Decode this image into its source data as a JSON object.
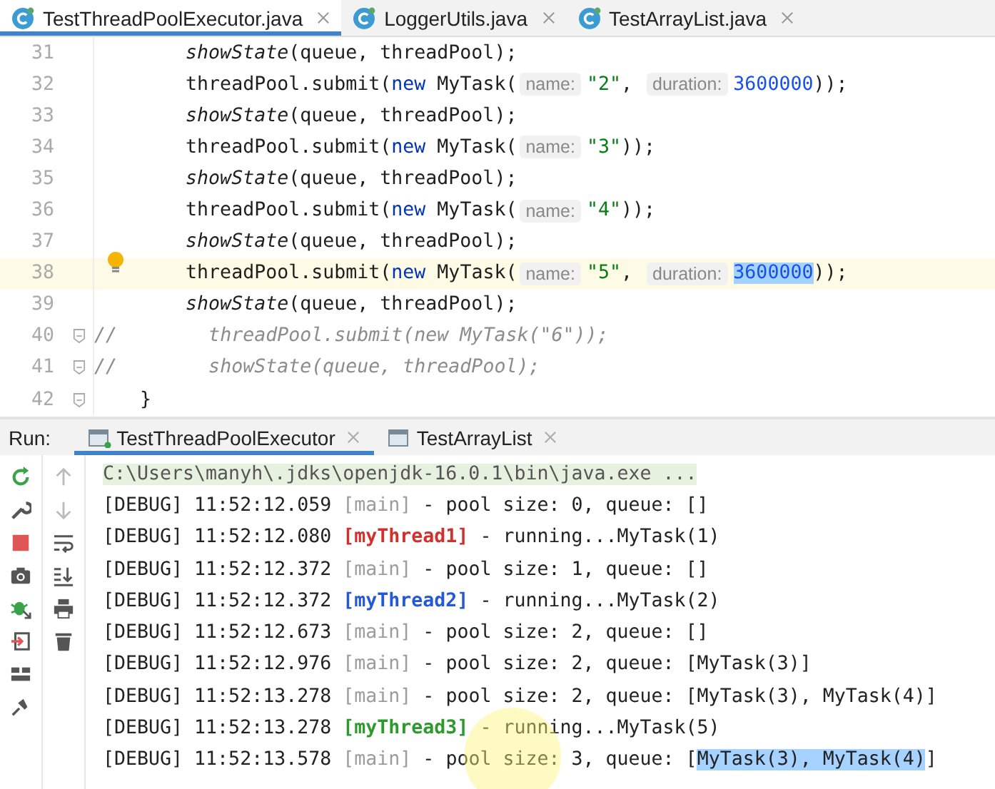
{
  "editor": {
    "tabs": [
      {
        "label": "TestThreadPoolExecutor.java",
        "selected": true
      },
      {
        "label": "LoggerUtils.java",
        "selected": false
      },
      {
        "label": "TestArrayList.java",
        "selected": false
      }
    ],
    "lines": [
      {
        "number": "31",
        "current": false,
        "bulb": false,
        "fold": false,
        "segments": [
          {
            "text": "        showState",
            "kind": "call"
          },
          {
            "text": "(queue, threadPool);",
            "kind": "plain"
          }
        ]
      },
      {
        "number": "32",
        "current": false,
        "bulb": false,
        "fold": false,
        "segments": [
          {
            "text": "        threadPool.submit(",
            "kind": "plain"
          },
          {
            "text": "new",
            "kind": "keyword"
          },
          {
            "text": " MyTask(",
            "kind": "plain"
          },
          {
            "text": "name:",
            "kind": "hint"
          },
          {
            "text": "\"2\"",
            "kind": "string"
          },
          {
            "text": ", ",
            "kind": "plain"
          },
          {
            "text": "duration:",
            "kind": "hint"
          },
          {
            "text": "3600000",
            "kind": "number"
          },
          {
            "text": "));",
            "kind": "plain"
          }
        ]
      },
      {
        "number": "33",
        "current": false,
        "bulb": false,
        "fold": false,
        "segments": [
          {
            "text": "        showState",
            "kind": "call"
          },
          {
            "text": "(queue, threadPool);",
            "kind": "plain"
          }
        ]
      },
      {
        "number": "34",
        "current": false,
        "bulb": false,
        "fold": false,
        "segments": [
          {
            "text": "        threadPool.submit(",
            "kind": "plain"
          },
          {
            "text": "new",
            "kind": "keyword"
          },
          {
            "text": " MyTask(",
            "kind": "plain"
          },
          {
            "text": "name:",
            "kind": "hint"
          },
          {
            "text": "\"3\"",
            "kind": "string"
          },
          {
            "text": "));",
            "kind": "plain"
          }
        ]
      },
      {
        "number": "35",
        "current": false,
        "bulb": false,
        "fold": false,
        "segments": [
          {
            "text": "        showState",
            "kind": "call"
          },
          {
            "text": "(queue, threadPool);",
            "kind": "plain"
          }
        ]
      },
      {
        "number": "36",
        "current": false,
        "bulb": false,
        "fold": false,
        "segments": [
          {
            "text": "        threadPool.submit(",
            "kind": "plain"
          },
          {
            "text": "new",
            "kind": "keyword"
          },
          {
            "text": " MyTask(",
            "kind": "plain"
          },
          {
            "text": "name:",
            "kind": "hint"
          },
          {
            "text": "\"4\"",
            "kind": "string"
          },
          {
            "text": "));",
            "kind": "plain"
          }
        ]
      },
      {
        "number": "37",
        "current": false,
        "bulb": false,
        "fold": false,
        "segments": [
          {
            "text": "        showState",
            "kind": "call"
          },
          {
            "text": "(queue, threadPool);",
            "kind": "plain"
          }
        ]
      },
      {
        "number": "38",
        "current": true,
        "bulb": true,
        "fold": false,
        "segments": [
          {
            "text": "        threadPool.submit(",
            "kind": "plain"
          },
          {
            "text": "new",
            "kind": "keyword"
          },
          {
            "text": " MyTask(",
            "kind": "plain"
          },
          {
            "text": "name:",
            "kind": "hint"
          },
          {
            "text": "\"5\"",
            "kind": "string"
          },
          {
            "text": ", ",
            "kind": "plain"
          },
          {
            "text": "duration:",
            "kind": "hint"
          },
          {
            "text": "3600000",
            "kind": "selected-number"
          },
          {
            "text": "));",
            "kind": "plain"
          }
        ]
      },
      {
        "number": "39",
        "current": false,
        "bulb": false,
        "fold": false,
        "segments": [
          {
            "text": "        showState",
            "kind": "call"
          },
          {
            "text": "(queue, threadPool);",
            "kind": "plain"
          }
        ]
      },
      {
        "number": "40",
        "current": false,
        "bulb": false,
        "fold": true,
        "segments": [
          {
            "text": "//",
            "kind": "comment"
          },
          {
            "text": "        threadPool.submit(new MyTask(\"6\"));",
            "kind": "comment"
          }
        ]
      },
      {
        "number": "41",
        "current": false,
        "bulb": false,
        "fold": true,
        "segments": [
          {
            "text": "//",
            "kind": "comment"
          },
          {
            "text": "        showState(queue, threadPool);",
            "kind": "comment"
          }
        ]
      },
      {
        "number": "42",
        "current": false,
        "bulb": false,
        "fold": true,
        "segments": [
          {
            "text": "    }",
            "kind": "plain"
          }
        ]
      }
    ]
  },
  "run": {
    "label": "Run:",
    "tabs": [
      {
        "label": "TestThreadPoolExecutor",
        "selected": true
      },
      {
        "label": "TestArrayList",
        "selected": false
      }
    ],
    "console": [
      {
        "kind": "command",
        "segments": [
          {
            "text": "C:\\Users\\manyh\\.jdks\\openjdk-16.0.1\\bin\\java.exe ...",
            "kind": "text"
          }
        ]
      },
      {
        "kind": "log",
        "segments": [
          {
            "text": "[DEBUG] 11:52:12.059 ",
            "kind": "text"
          },
          {
            "text": "[main]",
            "kind": "main"
          },
          {
            "text": " - pool size: 0, queue: []",
            "kind": "text"
          }
        ]
      },
      {
        "kind": "log",
        "segments": [
          {
            "text": "[DEBUG] 11:52:12.080 ",
            "kind": "text"
          },
          {
            "text": "[myThread1]",
            "kind": "thread",
            "color": "#d0312d"
          },
          {
            "text": " - running...MyTask(1)",
            "kind": "text"
          }
        ]
      },
      {
        "kind": "log",
        "segments": [
          {
            "text": "[DEBUG] 11:52:12.372 ",
            "kind": "text"
          },
          {
            "text": "[main]",
            "kind": "main"
          },
          {
            "text": " - pool size: 1, queue: []",
            "kind": "text"
          }
        ]
      },
      {
        "kind": "log",
        "segments": [
          {
            "text": "[DEBUG] 11:52:12.372 ",
            "kind": "text"
          },
          {
            "text": "[myThread2]",
            "kind": "thread",
            "color": "#2458d4"
          },
          {
            "text": " - running...MyTask(2)",
            "kind": "text"
          }
        ]
      },
      {
        "kind": "log",
        "segments": [
          {
            "text": "[DEBUG] 11:52:12.673 ",
            "kind": "text"
          },
          {
            "text": "[main]",
            "kind": "main"
          },
          {
            "text": " - pool size: 2, queue: []",
            "kind": "text"
          }
        ]
      },
      {
        "kind": "log",
        "segments": [
          {
            "text": "[DEBUG] 11:52:12.976 ",
            "kind": "text"
          },
          {
            "text": "[main]",
            "kind": "main"
          },
          {
            "text": " - pool size: 2, queue: [MyTask(3)]",
            "kind": "text"
          }
        ]
      },
      {
        "kind": "log",
        "segments": [
          {
            "text": "[DEBUG] 11:52:13.278 ",
            "kind": "text"
          },
          {
            "text": "[main]",
            "kind": "main"
          },
          {
            "text": " - pool size: 2, queue: [MyTask(3), MyTask(4)]",
            "kind": "text"
          }
        ]
      },
      {
        "kind": "log",
        "segments": [
          {
            "text": "[DEBUG] 11:52:13.278 ",
            "kind": "text"
          },
          {
            "text": "[myThread3]",
            "kind": "thread",
            "color": "#2e9a2e"
          },
          {
            "text": " - running...MyTask(5)",
            "kind": "text"
          }
        ]
      },
      {
        "kind": "log",
        "segments": [
          {
            "text": "[DEBUG] 11:52:13.578 ",
            "kind": "text"
          },
          {
            "text": "[main]",
            "kind": "main"
          },
          {
            "text": " - pool size: 3, queue: [",
            "kind": "text"
          },
          {
            "text": "MyTask(3), MyTask(4)",
            "kind": "selection"
          },
          {
            "text": "]",
            "kind": "text"
          }
        ]
      }
    ]
  }
}
